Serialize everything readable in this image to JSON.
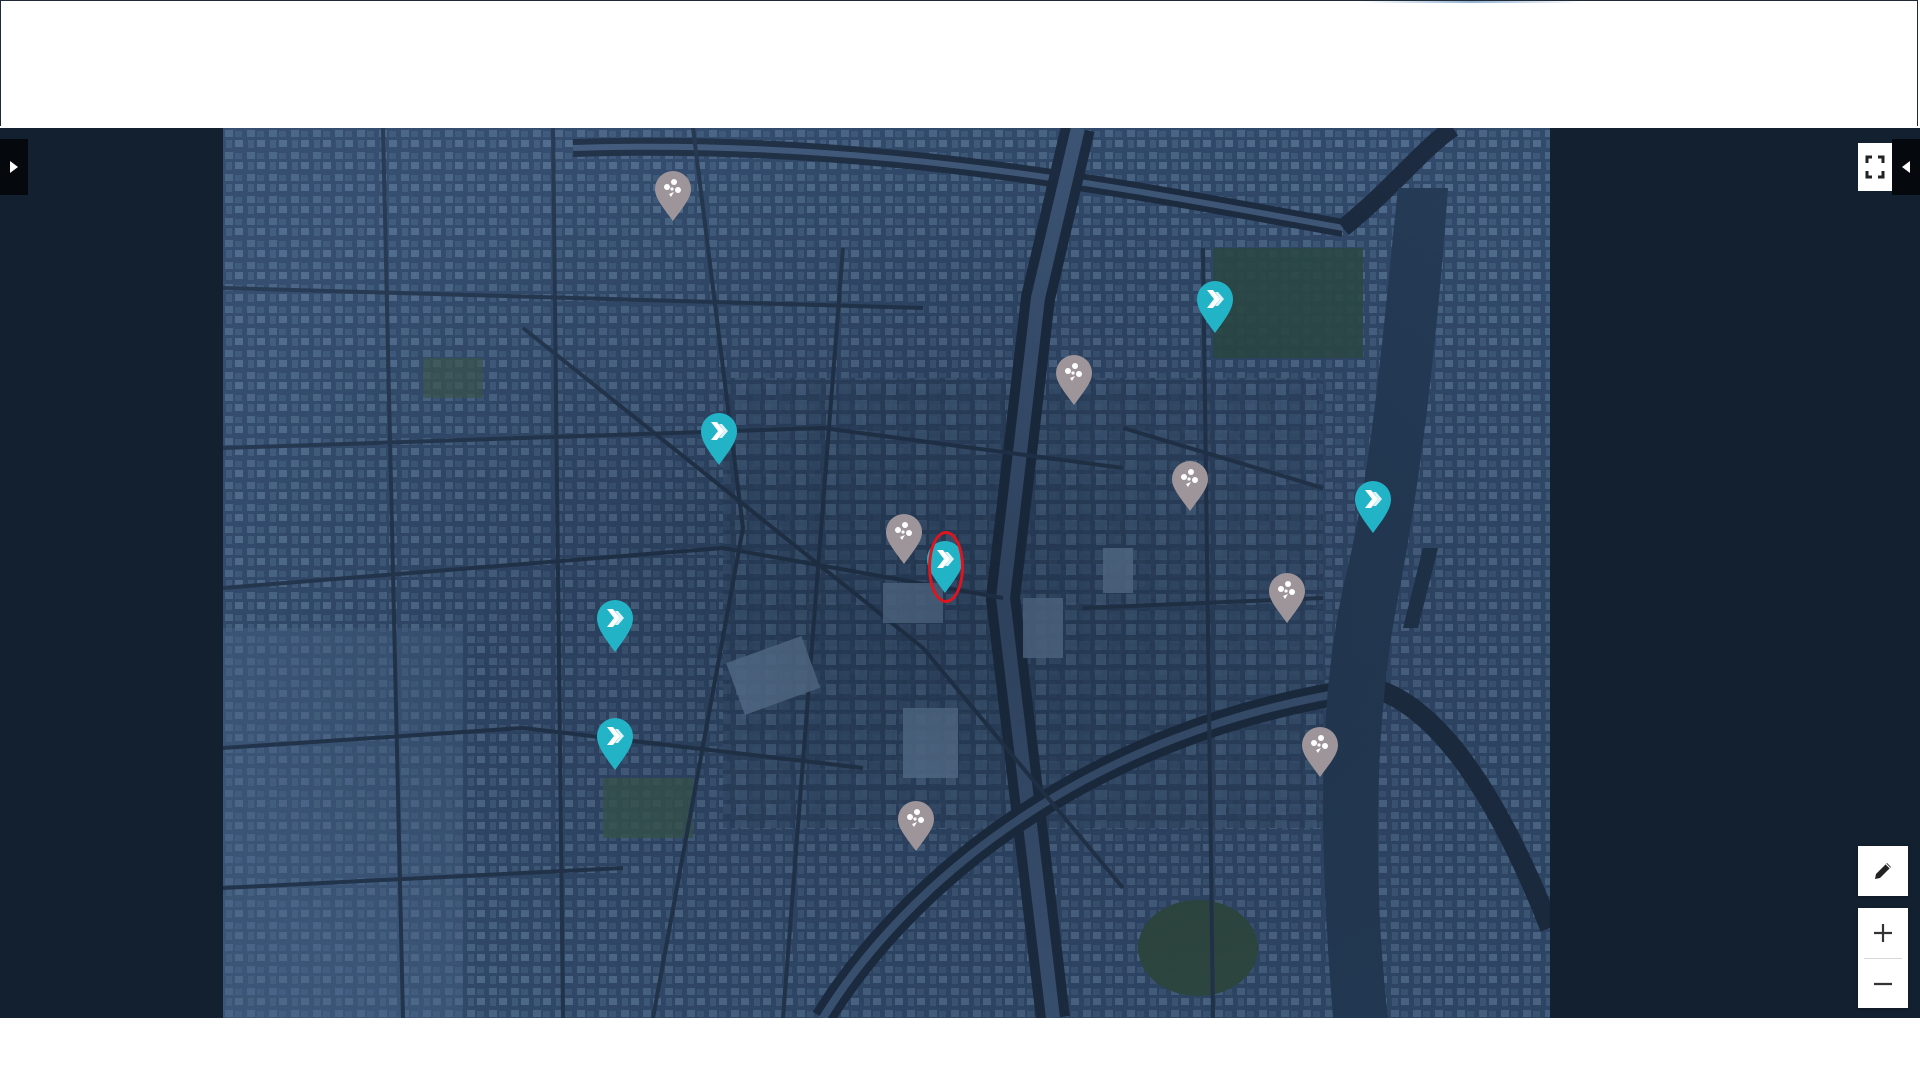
{
  "colors": {
    "map_base": "#2e4563",
    "side_panel": "#13202f",
    "poi_marker": "#23b3c7",
    "info_marker": "#9d959a",
    "selection": "#e0141e"
  },
  "toolbar": {
    "left_panel_toggle_icon": "caret-right-icon",
    "right_panel_toggle_icon": "caret-left-icon",
    "fullscreen_icon": "fullscreen-icon",
    "draw_icon": "pencil-icon",
    "zoom_in_icon": "plus-icon",
    "zoom_out_icon": "minus-icon"
  },
  "map": {
    "view": "satellite",
    "selected_marker": "poi-marker-5"
  },
  "markers": [
    {
      "id": "info-marker-1",
      "type": "info",
      "icon": "poi-cluster-icon"
    },
    {
      "id": "poi-marker-1",
      "type": "poi",
      "icon": "chevron-right-icon"
    },
    {
      "id": "info-marker-2",
      "type": "info",
      "icon": "poi-cluster-icon"
    },
    {
      "id": "poi-marker-2",
      "type": "poi",
      "icon": "chevron-right-icon"
    },
    {
      "id": "info-marker-3",
      "type": "info",
      "icon": "poi-cluster-icon"
    },
    {
      "id": "poi-marker-3",
      "type": "poi",
      "icon": "chevron-right-icon"
    },
    {
      "id": "info-marker-4",
      "type": "info",
      "icon": "poi-cluster-icon"
    },
    {
      "id": "poi-marker-5",
      "type": "poi",
      "icon": "chevron-right-icon",
      "selected": true
    },
    {
      "id": "info-marker-5",
      "type": "info",
      "icon": "poi-cluster-icon"
    },
    {
      "id": "poi-marker-4",
      "type": "poi",
      "icon": "chevron-right-icon"
    },
    {
      "id": "poi-marker-6",
      "type": "poi",
      "icon": "chevron-right-icon"
    },
    {
      "id": "info-marker-6",
      "type": "info",
      "icon": "poi-cluster-icon"
    },
    {
      "id": "info-marker-7",
      "type": "info",
      "icon": "poi-cluster-icon"
    }
  ]
}
